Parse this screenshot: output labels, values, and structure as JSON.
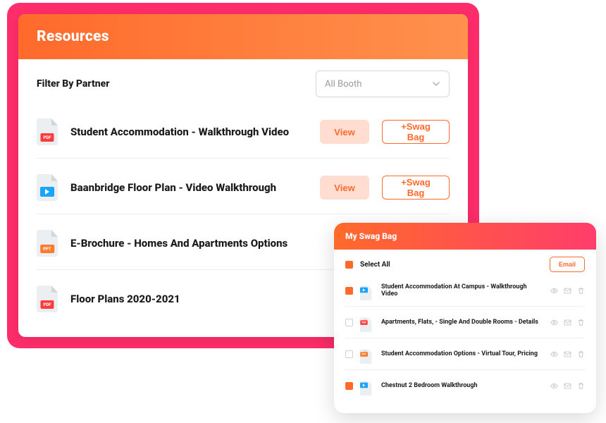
{
  "colors": {
    "brand_pink": "#ff2d6b",
    "brand_orange": "#ff6a2b",
    "view_bg": "#ffddd0"
  },
  "resources": {
    "header_title": "Resources",
    "filter_label": "Filter By Partner",
    "filter_select": {
      "selected": "All Booth"
    },
    "view_label": "View",
    "swag_label": "+Swag Bag",
    "items": [
      {
        "icon": "pdf",
        "title": "Student Accommodation - Walkthrough Video",
        "actions": true
      },
      {
        "icon": "video",
        "title": "Baanbridge Floor Plan - Video Walkthrough",
        "actions": true
      },
      {
        "icon": "ppt",
        "title": "E-Brochure - Homes And Apartments Options",
        "actions": false
      },
      {
        "icon": "pdf",
        "title": "Floor Plans 2020-2021",
        "actions": false
      }
    ]
  },
  "swag": {
    "header_title": "My Swag Bag",
    "select_all_label": "Select All",
    "email_label": "Email",
    "items": [
      {
        "checked": true,
        "icon": "video",
        "title": "Student Accommodation At Campus - Walkthrough Video"
      },
      {
        "checked": false,
        "icon": "pdf",
        "title": "Apartments, Flats, - Single And Double Rooms - Details"
      },
      {
        "checked": false,
        "icon": "ppt",
        "title": "Student Accommodation Options - Virtual Tour, Pricing"
      },
      {
        "checked": true,
        "icon": "video",
        "title": "Chestnut 2 Bedroom Walkthrough"
      }
    ]
  }
}
